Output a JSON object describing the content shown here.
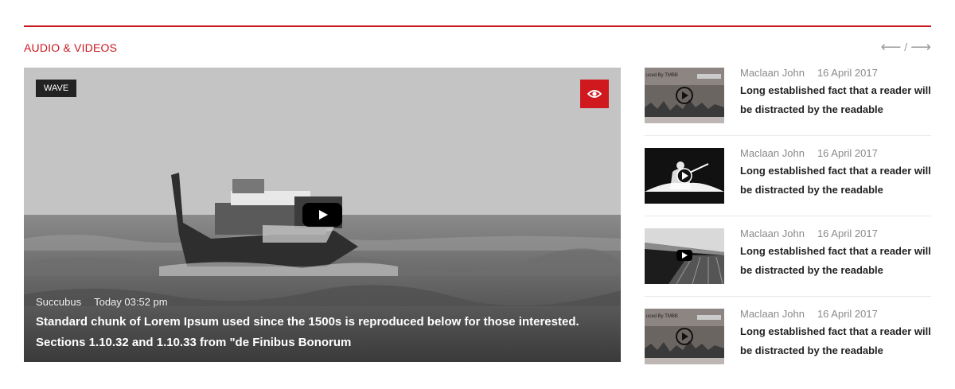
{
  "section": {
    "title": "AUDIO & VIDEOS",
    "nav": {
      "prev": "⟵",
      "separator": "/",
      "next": "⟶"
    }
  },
  "featured": {
    "tag": "WAVE",
    "author": "Succubus",
    "date": "Today 03:52 pm",
    "title": "Standard chunk of Lorem Ipsum used since the 1500s is reproduced below for those interested. Sections 1.10.32 and 1.10.33 from \"de Finibus Bonorum",
    "icons": {
      "view": "eye-icon",
      "play": "play-icon"
    },
    "colors": {
      "accent": "#d0191f"
    }
  },
  "items": [
    {
      "author": "Maclaan John",
      "date": "16 April 2017",
      "title": "Long established fact that a reader will be distracted by the readable",
      "thumb": "player-screenshot",
      "thumb_caption": "uced By TMBB"
    },
    {
      "author": "Maclaan John",
      "date": "16 April 2017",
      "title": "Long established fact that a reader will be distracted by the readable",
      "thumb": "guitarist-silhouette"
    },
    {
      "author": "Maclaan John",
      "date": "16 April 2017",
      "title": "Long established fact that a reader will be distracted by the readable",
      "thumb": "pier-bw"
    },
    {
      "author": "Maclaan John",
      "date": "16 April 2017",
      "title": "Long established fact that a reader will be distracted by the readable",
      "thumb": "player-screenshot",
      "thumb_caption": "uced By TMBB"
    }
  ],
  "colors": {
    "accent": "#c8161d",
    "rule": "#c8161d",
    "meta": "#8a8a8a"
  }
}
